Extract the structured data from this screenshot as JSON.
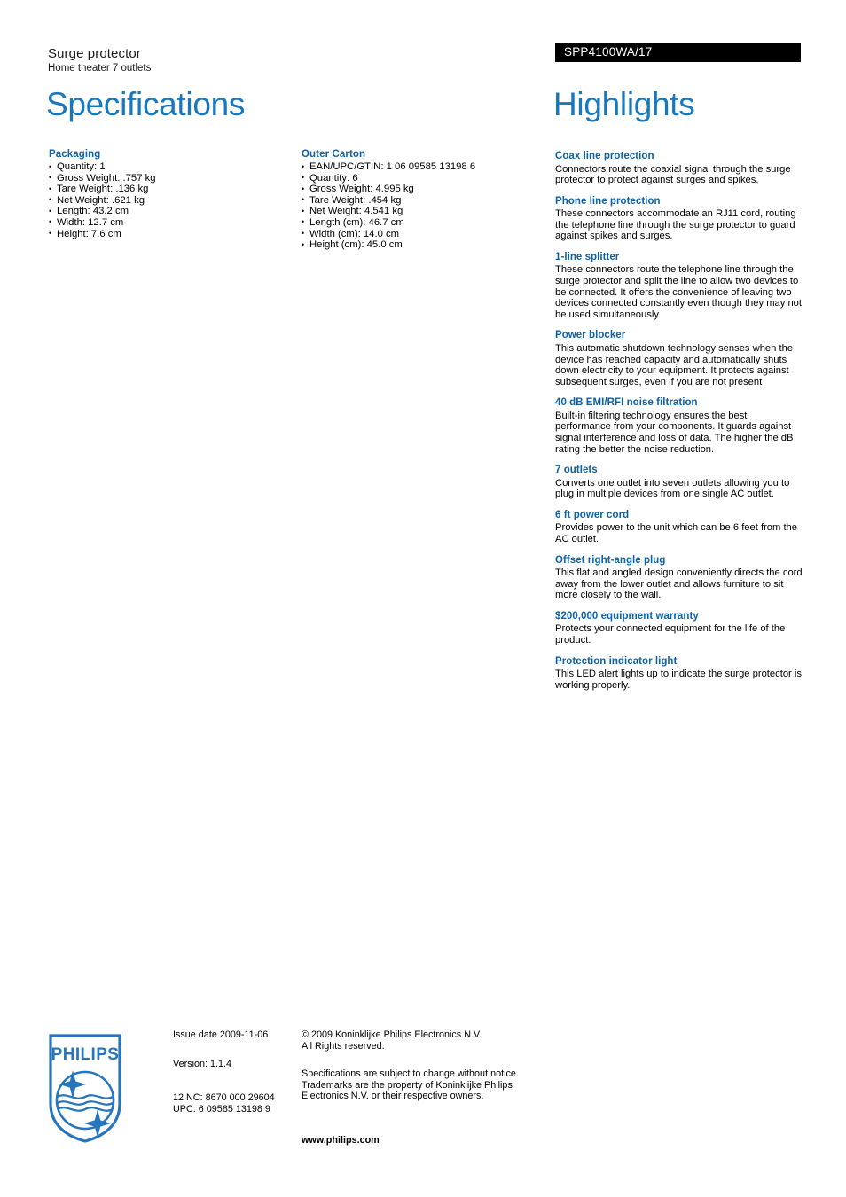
{
  "header": {
    "product_title": "Surge protector",
    "product_subtitle": "Home theater 7 outlets",
    "model_number": "SPP4100WA/17",
    "left_heading": "Specifications",
    "right_heading": "Highlights"
  },
  "specifications": {
    "groups": [
      {
        "title": "Packaging",
        "items": [
          "Quantity: 1",
          "Gross Weight: .757 kg",
          "Tare Weight: .136 kg",
          "Net Weight: .621 kg",
          "Length: 43.2 cm",
          "Width: 12.7 cm",
          "Height: 7.6 cm"
        ]
      },
      {
        "title": "Outer Carton",
        "items": [
          "EAN/UPC/GTIN: 1 06 09585 13198 6",
          "Quantity: 6",
          "Gross Weight: 4.995 kg",
          "Tare Weight: .454 kg",
          "Net Weight: 4.541 kg",
          "Length (cm): 46.7 cm",
          "Width (cm): 14.0 cm",
          "Height (cm): 45.0 cm"
        ]
      }
    ]
  },
  "highlights": {
    "items": [
      {
        "title": "Coax line protection",
        "desc": "Connectors route the coaxial signal through the surge protector to protect against surges and spikes."
      },
      {
        "title": "Phone line protection",
        "desc": "These connectors accommodate an RJ11 cord, routing the telephone line through the surge protector to guard against spikes and surges."
      },
      {
        "title": "1-line splitter",
        "desc": "These connectors route the telephone line through the surge protector and split the line to allow two devices to be connected. It offers the convenience of leaving two devices connected constantly even though they may not be used simultaneously"
      },
      {
        "title": "Power blocker",
        "desc": "This automatic shutdown technology senses when the device has reached capacity and automatically shuts down electricity to your equipment. It protects against subsequent surges, even if you are not present"
      },
      {
        "title": "40 dB EMI/RFI noise filtration",
        "desc": "Built-in filtering technology ensures the best performance from your components. It guards against signal interference and loss of data. The higher the dB rating the better the noise reduction."
      },
      {
        "title": "7 outlets",
        "desc": "Converts one outlet into seven outlets allowing you to plug in multiple devices from one single AC outlet."
      },
      {
        "title": "6 ft power cord",
        "desc": "Provides power to the unit which can be 6 feet from the AC outlet."
      },
      {
        "title": "Offset right-angle plug",
        "desc": "This flat and angled design conveniently directs the cord away from the lower outlet and allows furniture to sit more closely to the wall."
      },
      {
        "title": "$200,000 equipment warranty",
        "desc": "Protects your connected equipment for the life of the product."
      },
      {
        "title": "Protection indicator light",
        "desc": "This LED alert lights up to indicate the surge protector is working properly."
      }
    ]
  },
  "footer": {
    "logo_wordmark": "PHILIPS",
    "issue_date": "Issue date 2009-11-06",
    "version": "Version: 1.1.4",
    "twelve_nc": "12 NC: 8670 000 29604",
    "upc": "UPC: 6 09585 13198 9",
    "copyright_line1": "© 2009 Koninklijke Philips Electronics N.V.",
    "copyright_line2": "All Rights reserved.",
    "disclaimer_line1": "Specifications are subject to change without notice.",
    "disclaimer_line2": "Trademarks are the property of Koninklijke Philips",
    "disclaimer_line3": "Electronics N.V. or their respective owners.",
    "website": "www.philips.com"
  },
  "colors": {
    "title_blue": "#1878bd",
    "heading_blue": "#0b62ab",
    "banner_black": "#000000",
    "logo_blue": "#2776bd"
  }
}
